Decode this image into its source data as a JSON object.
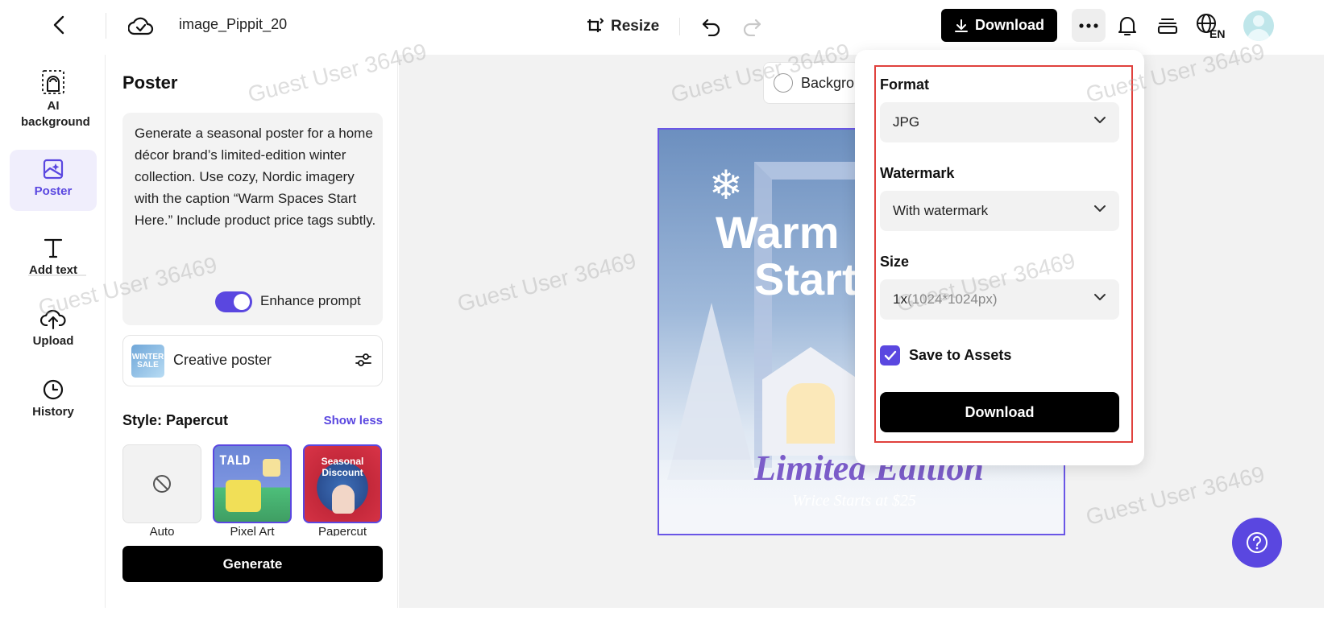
{
  "header": {
    "file_title": "image_Pippit_20",
    "resize_label": "Resize",
    "download_label": "Download",
    "language_code": "EN"
  },
  "left_rail": {
    "items": [
      {
        "label": "AI background",
        "icon": "ai-background-icon"
      },
      {
        "label": "Poster",
        "icon": "poster-icon"
      },
      {
        "label": "Add text",
        "icon": "text-icon"
      },
      {
        "label": "Upload",
        "icon": "upload-icon"
      },
      {
        "label": "History",
        "icon": "history-icon"
      }
    ],
    "active": "Poster"
  },
  "panel": {
    "title": "Poster",
    "prompt": "Generate a seasonal poster for a home décor brand’s limited-edition winter collection. Use cozy, Nordic imagery with the caption “Warm Spaces Start Here.” Include product price tags subtly.",
    "enhance_label": "Enhance prompt",
    "enhance_on": true,
    "creative_label": "Creative poster",
    "creative_thumb_text": "WINTER SALE",
    "style_title": "Style: Papercut",
    "show_less": "Show less",
    "styles": [
      {
        "name": "Auto",
        "thumb_text": ""
      },
      {
        "name": "Pixel Art",
        "thumb_text": "TALD"
      },
      {
        "name": "Papercut",
        "thumb_text": "Seasonal Discount"
      }
    ],
    "selected_style": "Papercut",
    "generate_label": "Generate"
  },
  "canvas": {
    "background_chip": "Backgro",
    "poster": {
      "headline_1": "Warm",
      "headline_2": "Start",
      "tagline": "Limited Edition",
      "price": "Wrice Starts at $25"
    }
  },
  "download_popup": {
    "format_label": "Format",
    "format_value": "JPG",
    "watermark_label": "Watermark",
    "watermark_value": "With watermark",
    "size_label": "Size",
    "size_value": "1x",
    "size_detail": "(1024*1024px)",
    "save_label": "Save to Assets",
    "save_checked": true,
    "download_label": "Download"
  },
  "watermark_text": "Guest User 36469",
  "colors": {
    "accent": "#5a47e0",
    "highlight_outline": "#e0413d",
    "canvas_bg": "#f2f2f2"
  }
}
